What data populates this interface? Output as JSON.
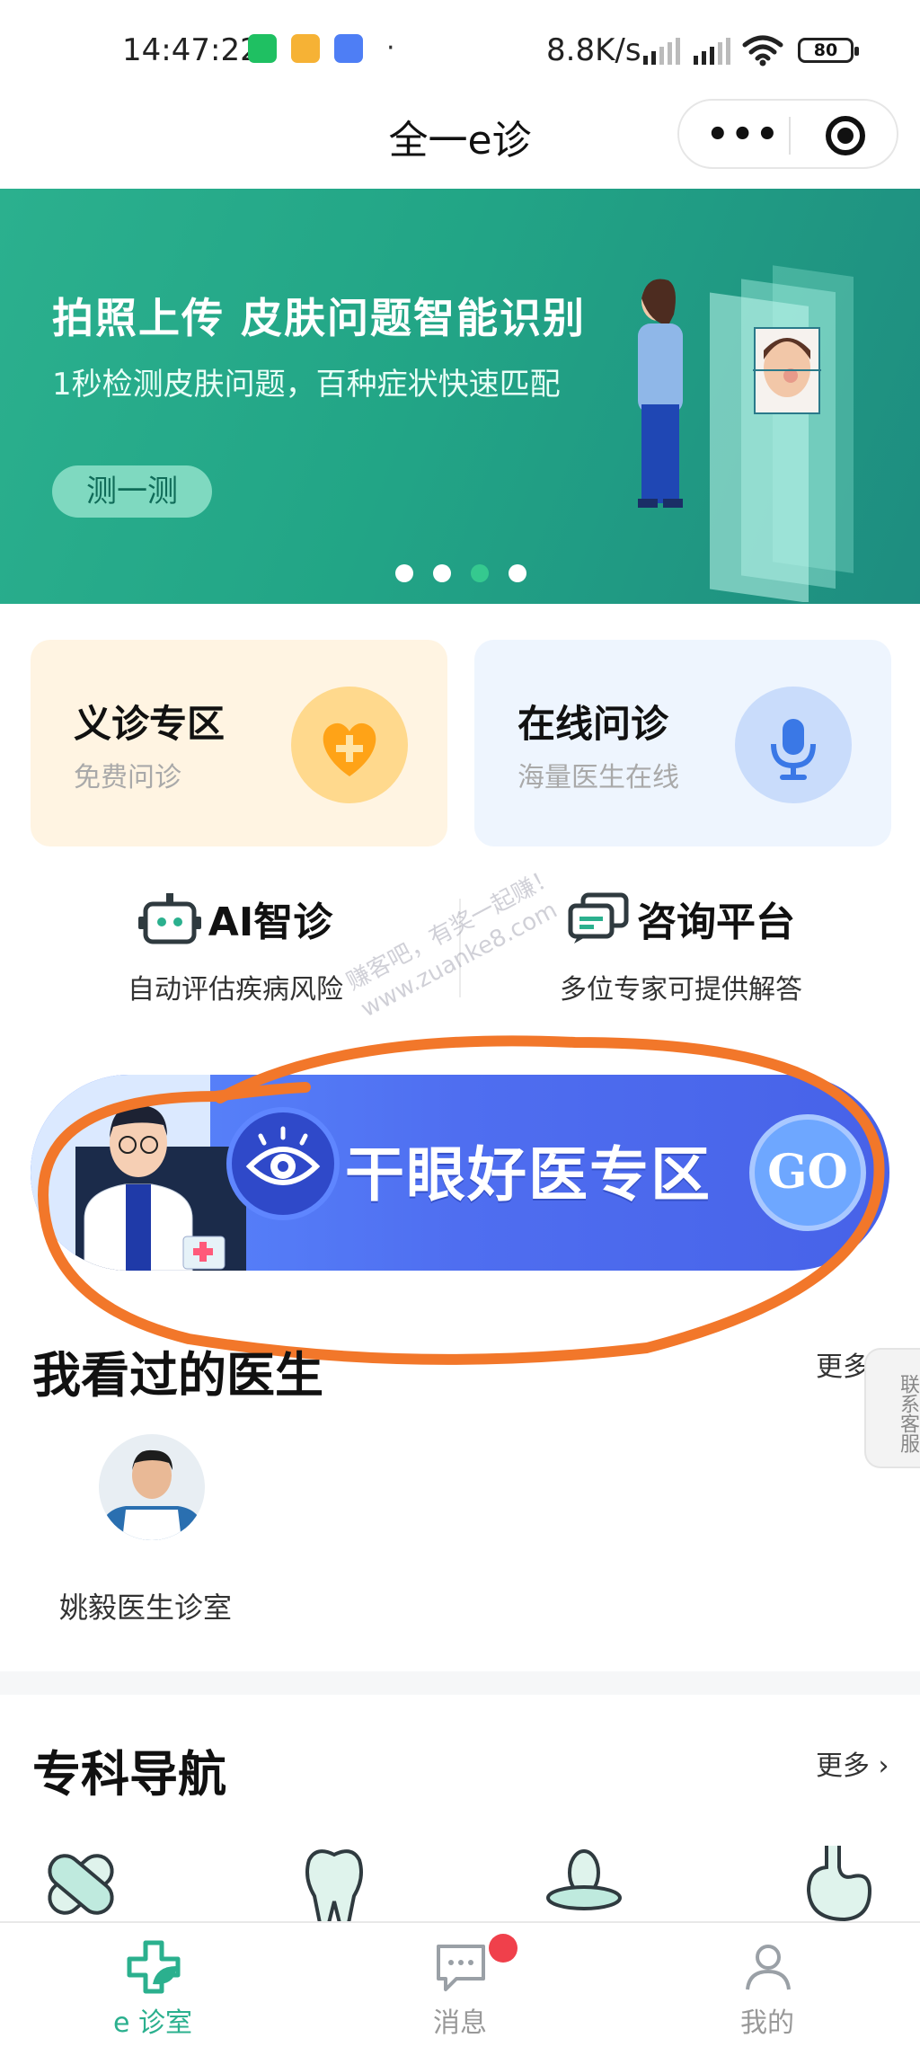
{
  "status_bar": {
    "time": "14:47:22",
    "dot": "·",
    "net_speed": "8.8K/s",
    "battery": "80"
  },
  "nav": {
    "title": "全一e诊",
    "more_glyph": "•••"
  },
  "banner": {
    "title": "拍照上传 皮肤问题智能识别",
    "subtitle": "1秒检测皮肤问题，百种症状快速匹配",
    "button": "测一测",
    "slide_count": 4,
    "active_slide": 3
  },
  "service_cards": [
    {
      "title": "义诊专区",
      "subtitle": "免费问诊",
      "icon": "heart-plus-icon"
    },
    {
      "title": "在线问诊",
      "subtitle": "海量医生在线",
      "icon": "microphone-icon"
    }
  ],
  "features": [
    {
      "title": "AI智诊",
      "subtitle": "自动评估疾病风险",
      "icon": "robot-icon"
    },
    {
      "title": "咨询平台",
      "subtitle": "多位专家可提供解答",
      "icon": "chat-bubbles-icon"
    }
  ],
  "watermark": {
    "line1": "赚客吧，有奖一起赚！",
    "line2": "www.zuanke8.com"
  },
  "dry_eye_banner": {
    "text": "干眼好医专区",
    "go": "GO"
  },
  "recent_doctors": {
    "title": "我看过的医生",
    "more": "更多",
    "items": [
      {
        "name": "姚毅医生诊室"
      }
    ]
  },
  "side_contact": "联系客服",
  "departments": {
    "title": "专科导航",
    "more": "更多",
    "icons": [
      "bandage-icon",
      "tooth-icon",
      "pacifier-icon",
      "stomach-icon"
    ]
  },
  "tabbar": {
    "items": [
      {
        "label": "e 诊室",
        "active": true
      },
      {
        "label": "消息",
        "active": false
      },
      {
        "label": "我的",
        "active": false
      }
    ]
  },
  "colors": {
    "brand_green": "#2bb08e",
    "banner_blue": "#4f6ef0",
    "annotation_orange": "#f2772a",
    "badge_red": "#f0404b"
  }
}
